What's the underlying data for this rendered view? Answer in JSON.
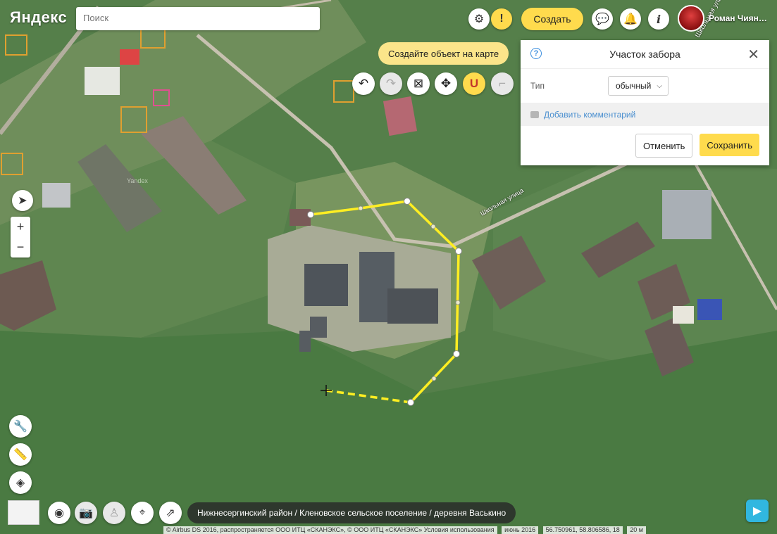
{
  "header": {
    "logo": "Яндекс",
    "search_placeholder": "Поиск",
    "create_label": "Создать",
    "user_name": "Роман Чиян…"
  },
  "hint": "Создайте объект на карте",
  "toolbar": {
    "undo_icon": "undo-icon",
    "redo_icon": "redo-icon",
    "delete_icon": "delete-icon",
    "move_icon": "move-icon",
    "snap_icon": "magnet-icon",
    "style_icon": "corner-icon"
  },
  "panel": {
    "title": "Участок забора",
    "type_label": "Тип",
    "type_value": "обычный",
    "comment_link": "Добавить комментарий",
    "cancel_label": "Отменить",
    "save_label": "Сохранить"
  },
  "map_labels": {
    "street_center": "Школьная улица",
    "street_top": "Школьная улица",
    "watermark": "Yandex"
  },
  "breadcrumb": "Нижнесергинский район / Кленовское сельское поселение / деревня Васькино",
  "footer": {
    "copyright": "© Airbus DS 2016, распространяется ООО ИТЦ «СКАНЭКС», © ООО ИТЦ «СКАНЭКС» Условия использования",
    "date": "июнь 2016",
    "coords": "56.750961, 58.806586, 18",
    "scale": "20 м"
  },
  "colors": {
    "accent": "#ffdb4d",
    "fence_line": "#ffee22",
    "link": "#4a8fcf"
  }
}
